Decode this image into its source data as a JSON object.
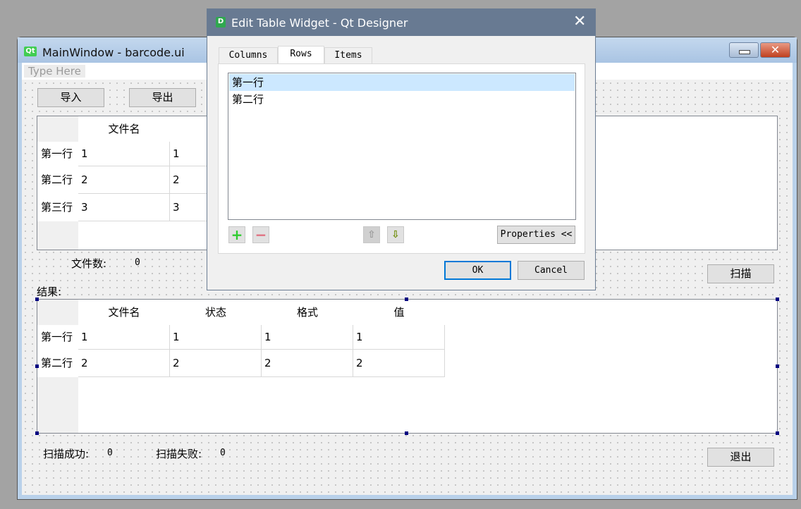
{
  "main_window": {
    "title": "MainWindow - barcode.ui",
    "logo": "Qt",
    "menu_placeholder": "Type Here",
    "import_button": "导入",
    "export_button": "导出",
    "file_table": {
      "headers": [
        "文件名"
      ],
      "row_headers": [
        "第一行",
        "第二行",
        "第三行"
      ],
      "rows": [
        [
          "1",
          "1"
        ],
        [
          "2",
          "2"
        ],
        [
          "3",
          "3"
        ]
      ]
    },
    "file_count_label": "文件数:",
    "file_count_value": "0",
    "scan_button": "扫描",
    "result_label": "结果:",
    "result_table": {
      "headers": [
        "文件名",
        "状态",
        "格式",
        "值"
      ],
      "row_headers": [
        "第一行",
        "第二行"
      ],
      "rows": [
        [
          "1",
          "1",
          "1",
          "1"
        ],
        [
          "2",
          "2",
          "2",
          "2"
        ]
      ]
    },
    "scan_success_label": "扫描成功:",
    "scan_success_value": "0",
    "scan_fail_label": "扫描失败:",
    "scan_fail_value": "0",
    "exit_button": "退出",
    "close_glyph": "✕"
  },
  "dialog": {
    "title": "Edit Table Widget - Qt Designer",
    "logo": "D",
    "close_glyph": "✕",
    "tabs": [
      {
        "label": "Columns"
      },
      {
        "label": "Rows",
        "active": true
      },
      {
        "label": "Items"
      }
    ],
    "rows_list": [
      {
        "label": "第一行",
        "selected": true
      },
      {
        "label": "第二行"
      }
    ],
    "add_glyph": "+",
    "remove_glyph": "−",
    "up_glyph": "⇧",
    "down_glyph": "⇩",
    "properties_button": "Properties <<",
    "ok_button": "OK",
    "cancel_button": "Cancel"
  },
  "colors": {
    "dialog_title_bar": "#687a92",
    "selection": "#cce8ff",
    "focus_border": "#0078d7"
  }
}
